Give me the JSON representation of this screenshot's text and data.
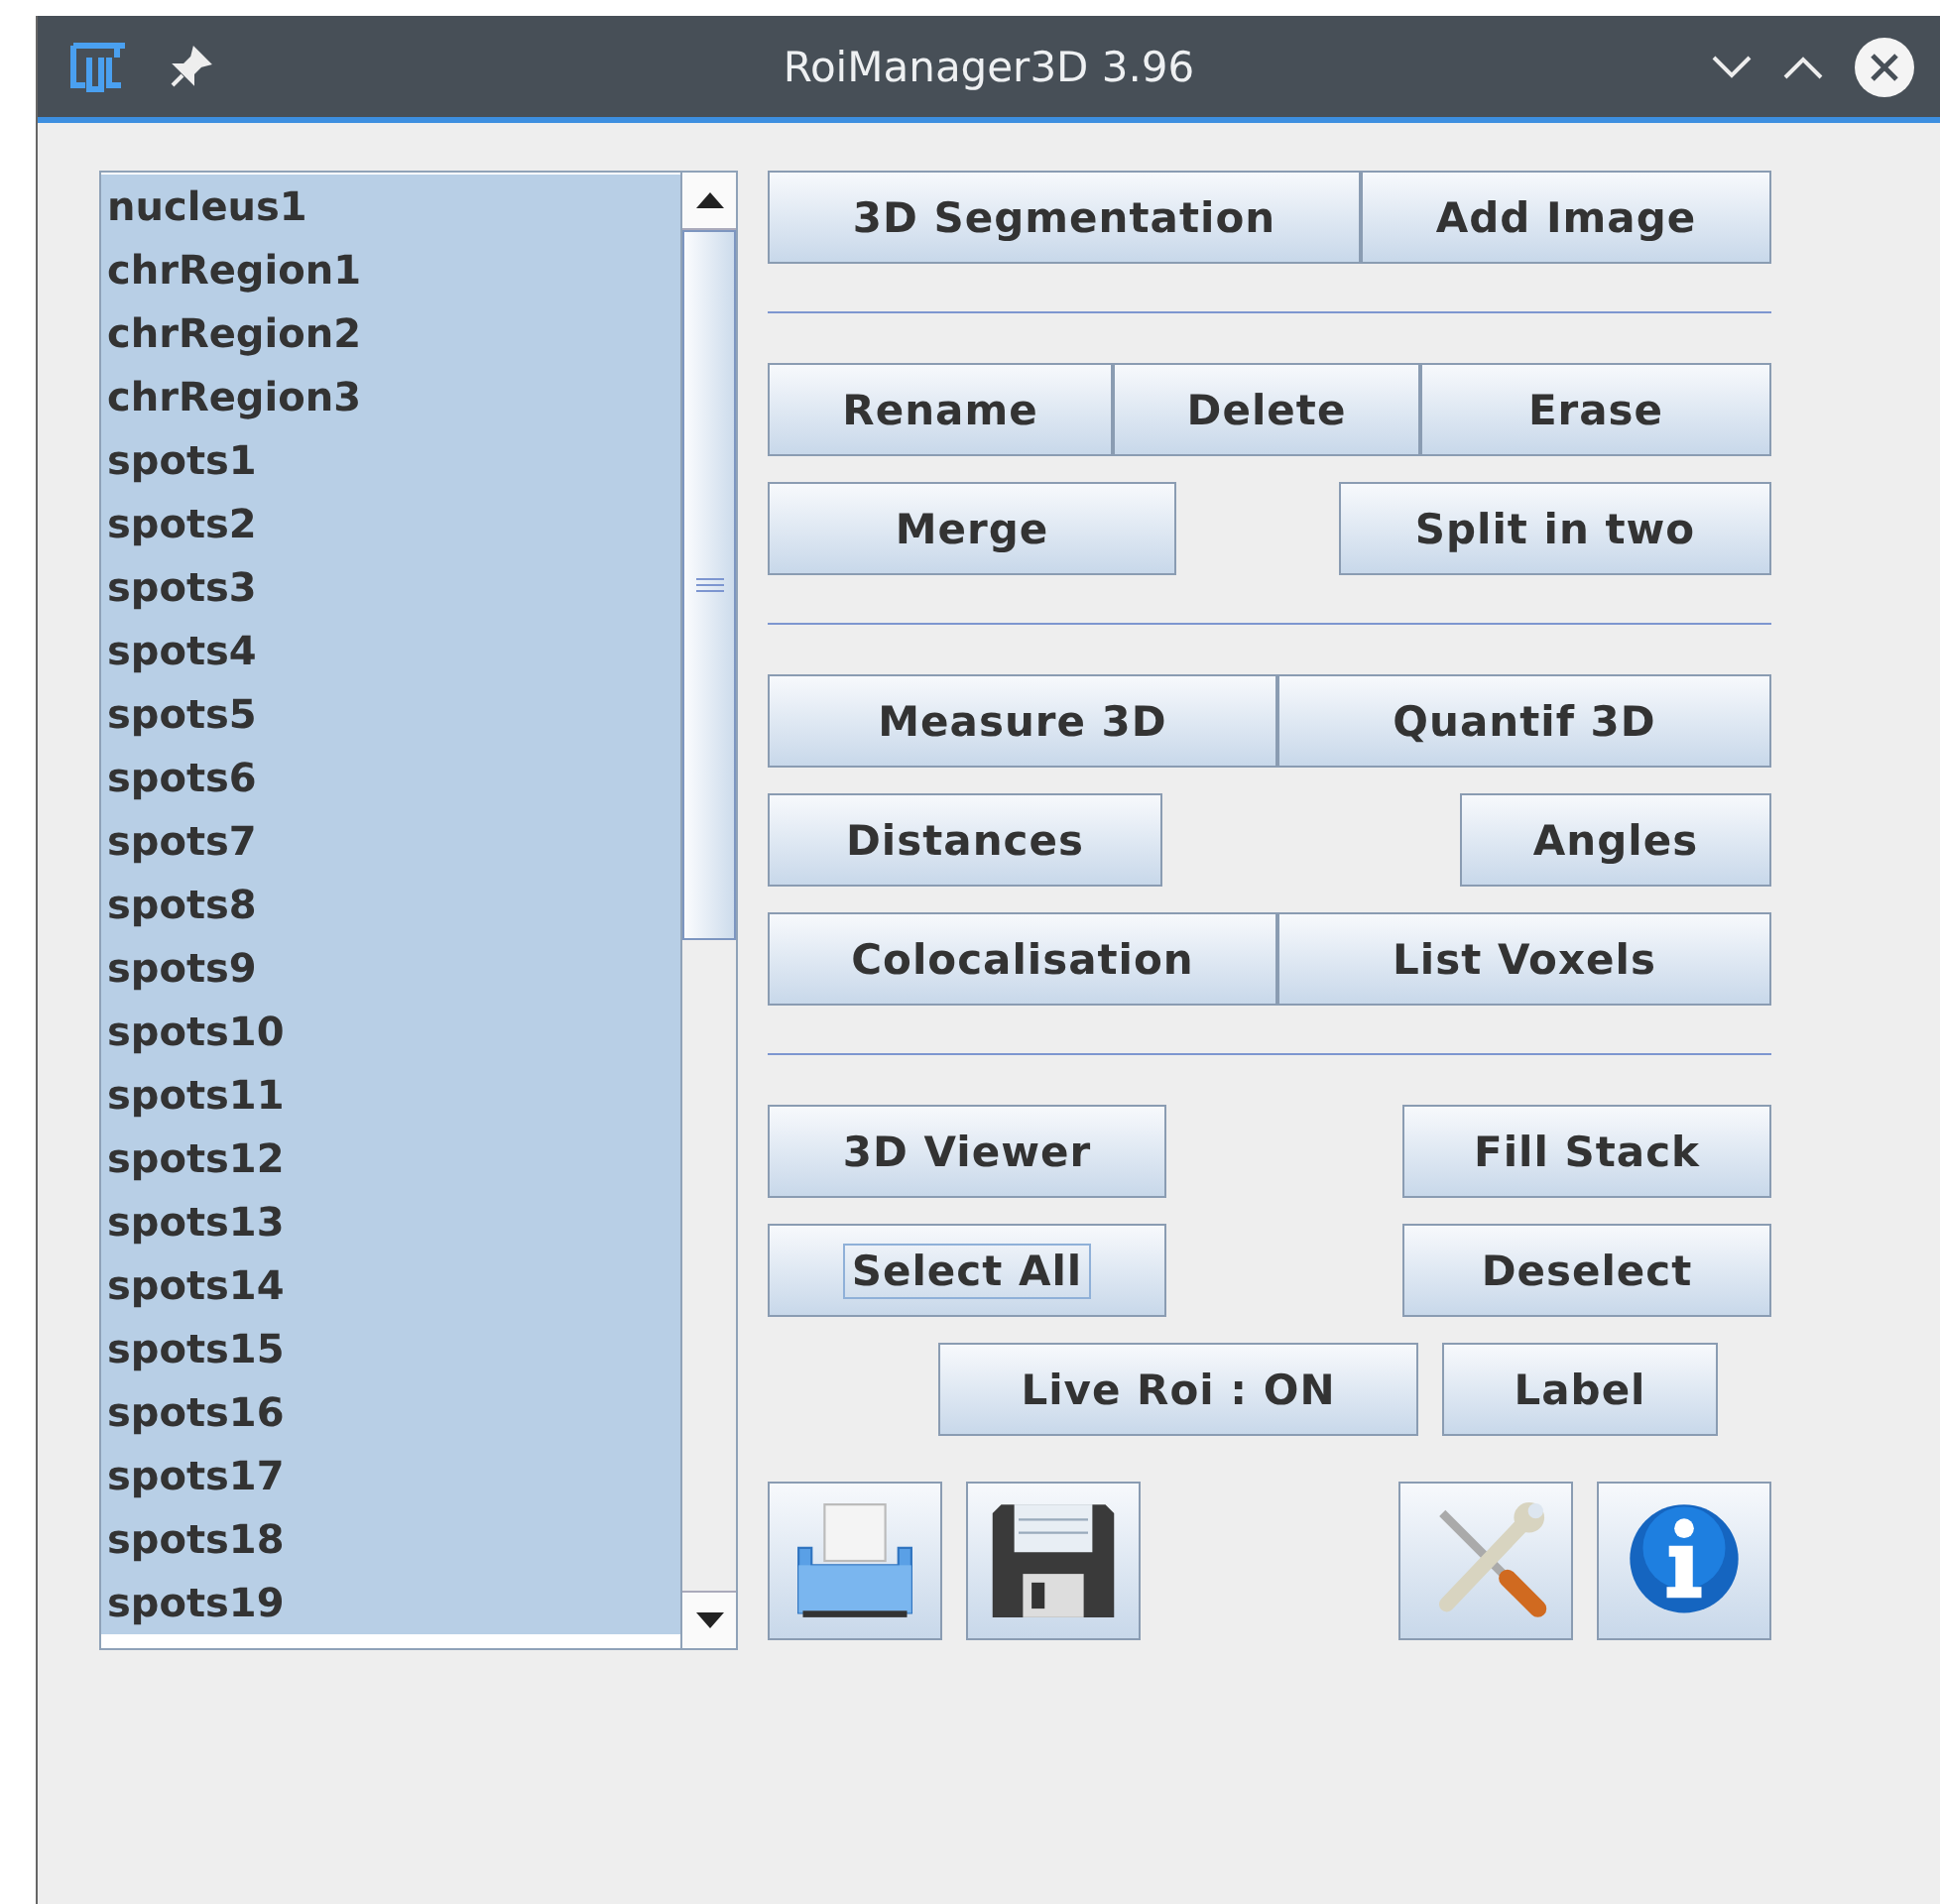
{
  "window": {
    "title": "RoiManager3D 3.96"
  },
  "roi_list": {
    "items": [
      {
        "label": "nucleus1",
        "selected": true
      },
      {
        "label": "chrRegion1",
        "selected": true
      },
      {
        "label": "chrRegion2",
        "selected": true
      },
      {
        "label": "chrRegion3",
        "selected": true
      },
      {
        "label": "spots1",
        "selected": true
      },
      {
        "label": "spots2",
        "selected": true
      },
      {
        "label": "spots3",
        "selected": true
      },
      {
        "label": "spots4",
        "selected": true
      },
      {
        "label": "spots5",
        "selected": true
      },
      {
        "label": "spots6",
        "selected": true
      },
      {
        "label": "spots7",
        "selected": true
      },
      {
        "label": "spots8",
        "selected": true
      },
      {
        "label": "spots9",
        "selected": true
      },
      {
        "label": "spots10",
        "selected": true
      },
      {
        "label": "spots11",
        "selected": true
      },
      {
        "label": "spots12",
        "selected": true
      },
      {
        "label": "spots13",
        "selected": true
      },
      {
        "label": "spots14",
        "selected": true
      },
      {
        "label": "spots15",
        "selected": true
      },
      {
        "label": "spots16",
        "selected": true
      },
      {
        "label": "spots17",
        "selected": true
      },
      {
        "label": "spots18",
        "selected": true
      },
      {
        "label": "spots19",
        "selected": true
      }
    ]
  },
  "rows": [
    {
      "kind": "buttons",
      "buttons": [
        {
          "label": "3D Segmentation",
          "focused": false
        },
        {
          "label": "Add Image",
          "focused": false
        }
      ]
    },
    {
      "kind": "separator"
    },
    {
      "kind": "buttons",
      "buttons": [
        {
          "label": "Rename",
          "focused": false
        },
        {
          "label": "Delete",
          "focused": false
        },
        {
          "label": "Erase",
          "focused": false
        }
      ]
    },
    {
      "kind": "buttons",
      "buttons": [
        {
          "label": "Merge",
          "focused": false
        },
        {
          "label": "Split in two",
          "focused": false
        }
      ]
    },
    {
      "kind": "separator"
    },
    {
      "kind": "buttons",
      "buttons": [
        {
          "label": "Measure 3D",
          "focused": false
        },
        {
          "label": "Quantif 3D",
          "focused": false
        }
      ]
    },
    {
      "kind": "buttons",
      "buttons": [
        {
          "label": "Distances",
          "focused": false
        },
        {
          "label": "Angles",
          "focused": false
        }
      ]
    },
    {
      "kind": "buttons",
      "buttons": [
        {
          "label": "Colocalisation",
          "focused": false
        },
        {
          "label": "List Voxels",
          "focused": false
        }
      ]
    },
    {
      "kind": "separator"
    },
    {
      "kind": "buttons",
      "buttons": [
        {
          "label": "3D Viewer",
          "focused": false
        },
        {
          "label": "Fill Stack",
          "focused": false
        }
      ]
    },
    {
      "kind": "buttons",
      "buttons": [
        {
          "label": "Select All",
          "focused": true
        },
        {
          "label": "Deselect",
          "focused": false
        }
      ]
    },
    {
      "kind": "buttons",
      "buttons": [
        {
          "label": "Live Roi : ON",
          "focused": false
        },
        {
          "label": "Label",
          "focused": false
        }
      ]
    },
    {
      "kind": "icons",
      "icons": [
        {
          "kind": "printer"
        },
        {
          "kind": "floppy"
        },
        {
          "kind": "tools"
        },
        {
          "kind": "info"
        }
      ]
    }
  ]
}
